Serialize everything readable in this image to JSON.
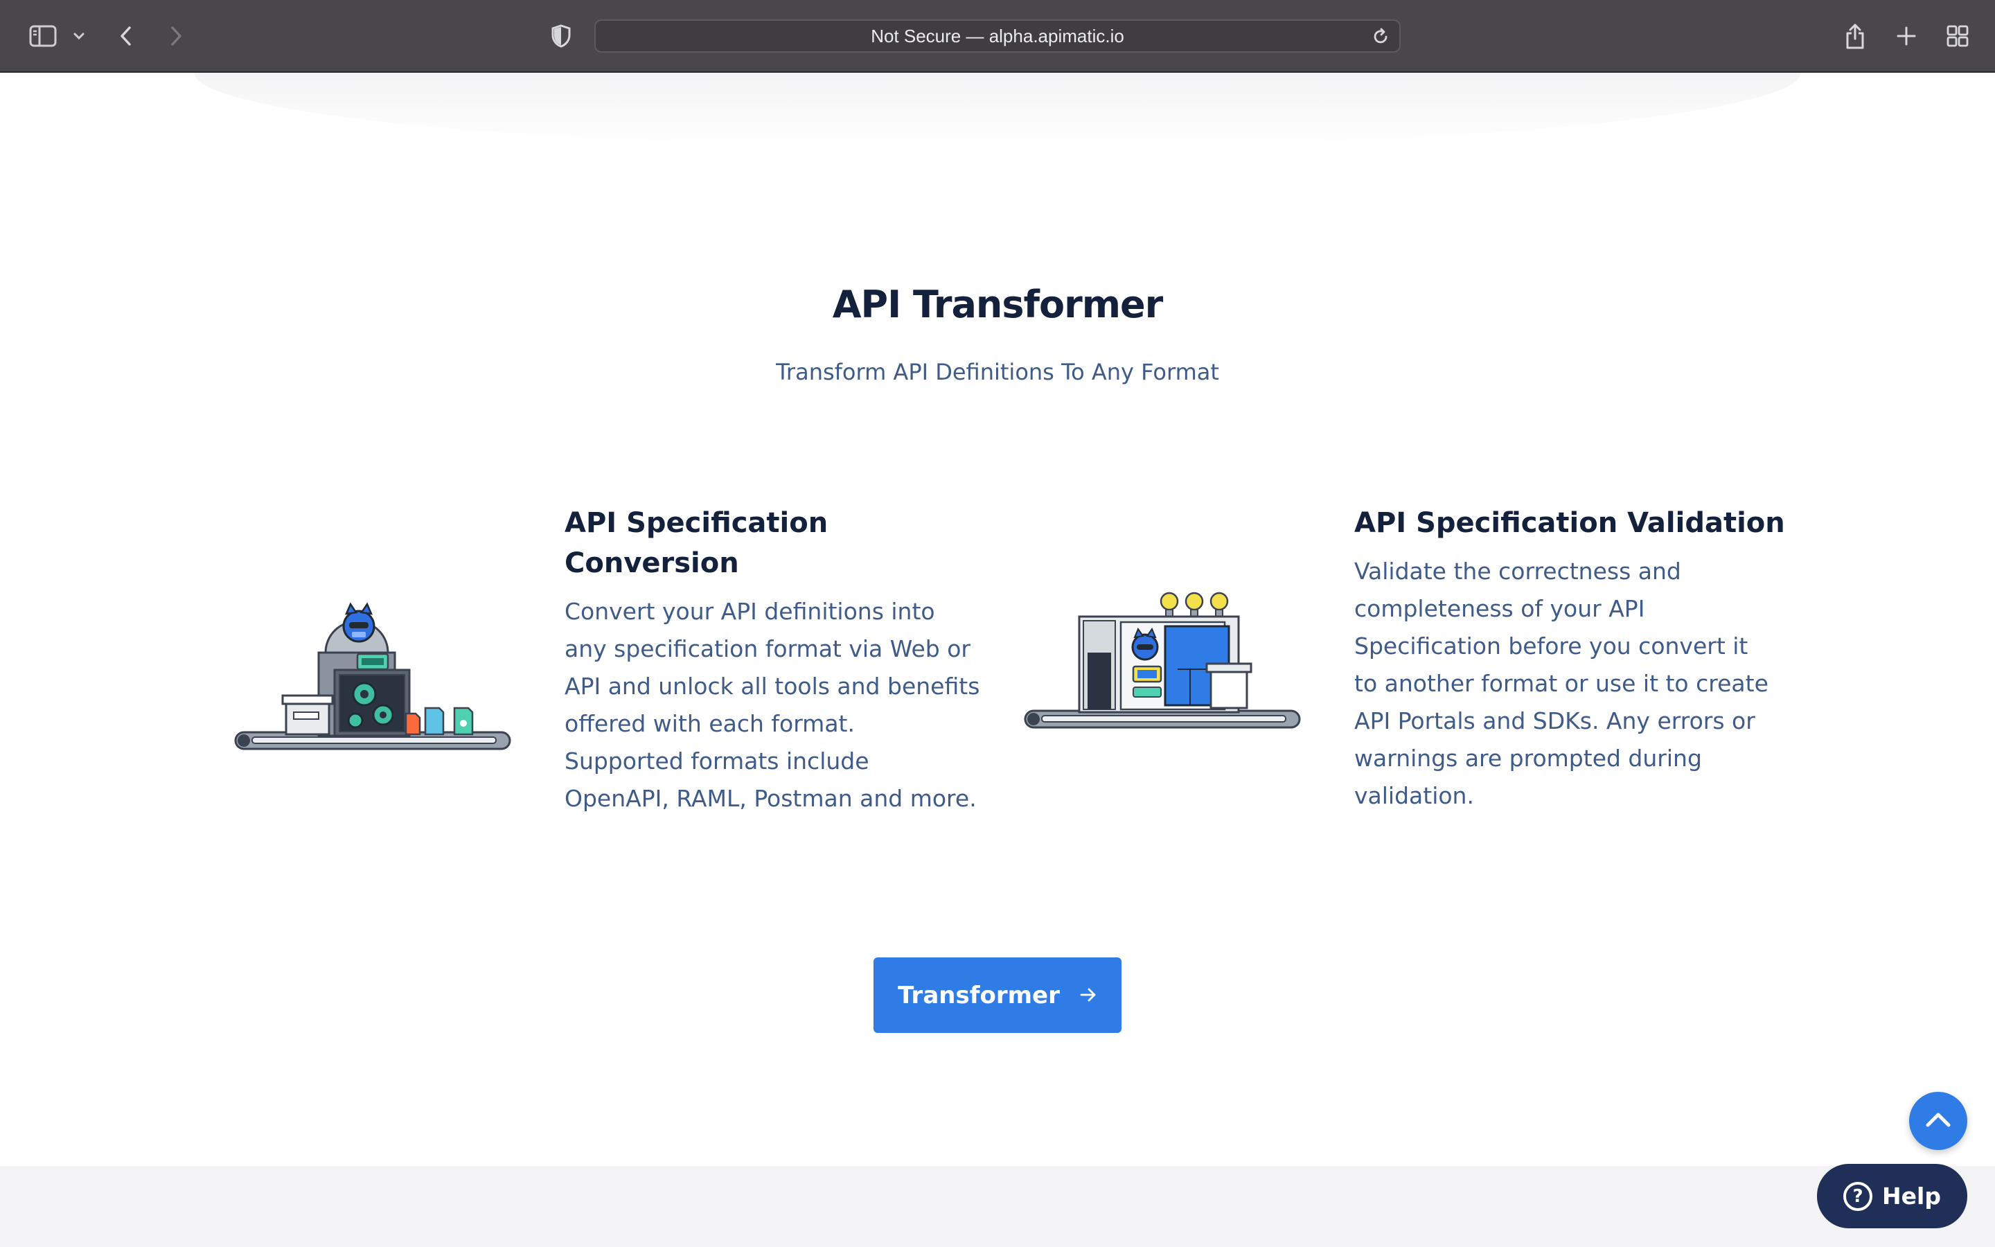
{
  "browser": {
    "address_text": "Not Secure — alpha.apimatic.io"
  },
  "hero": {
    "title": "API Transformer",
    "subtitle": "Transform API Definitions To Any Format"
  },
  "features": [
    {
      "title_line1": "API Specification",
      "title_line2": "Conversion",
      "description": "Convert your API definitions into any specification format via Web or API and unlock all tools and benefits offered with each format. Supported formats include OpenAPI, RAML, Postman and more."
    },
    {
      "title": "API Specification Validation",
      "description": "Validate the correctness and completeness of your API Specification before you convert it to another format or use it to create API Portals and SDKs. Any errors or warnings are prompted during validation."
    }
  ],
  "cta": {
    "label": "Transformer"
  },
  "widgets": {
    "help_label": "Help"
  },
  "colors": {
    "accent": "#2f7ce6",
    "heading": "#14213d",
    "body_text": "#3f5b8a",
    "help_bg": "#1f2f57"
  },
  "icons": [
    "sidebar-icon",
    "chevron-down-icon",
    "back-icon",
    "forward-icon",
    "shield-icon",
    "reload-icon",
    "share-icon",
    "plus-icon",
    "tab-grid-icon",
    "arrow-right-icon",
    "chevron-up-icon",
    "question-icon"
  ]
}
